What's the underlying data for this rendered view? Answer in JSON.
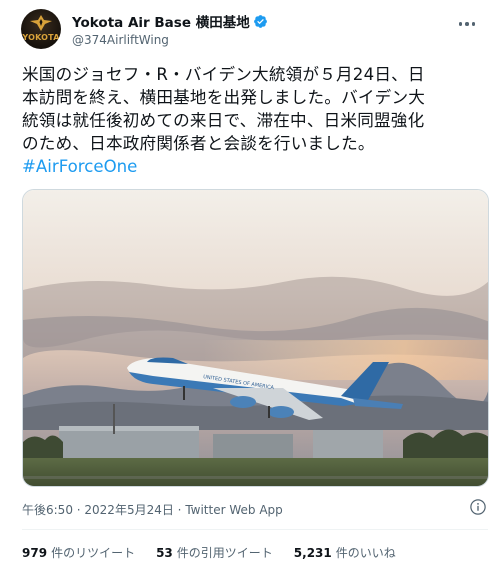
{
  "header": {
    "avatar_text": "YOKOTA",
    "display_name": "Yokota Air Base 横田基地",
    "handle": "@374AirliftWing",
    "verified_icon": "verified-badge-icon",
    "more_icon": "more-options-icon"
  },
  "tweet": {
    "text_lines": [
      "米国のジョセフ・R・バイデン大統領が５月24日、日",
      "本訪問を終え、横田基地を出発しました。バイデン大",
      "統領は就任後初めての来日で、滞在中、日米同盟強化",
      "のため、日本政府関係者と会談を行いました。"
    ],
    "hashtag": "#AirForceOne",
    "hashtag_color": "#1d9bf0"
  },
  "media": {
    "aircraft_label": "UNITED STATES OF AMERICA"
  },
  "meta": {
    "time": "午後6:50",
    "separator": " · ",
    "date": "2022年5月24日",
    "source": "Twitter Web App",
    "info_icon": "info-icon"
  },
  "stats": [
    {
      "count": "979",
      "label": "件のリツイート"
    },
    {
      "count": "53",
      "label": "件の引用ツイート"
    },
    {
      "count": "5,231",
      "label": "件のいいね"
    }
  ],
  "colors": {
    "text": "#0f1419",
    "secondary": "#536471",
    "accent": "#1d9bf0"
  }
}
